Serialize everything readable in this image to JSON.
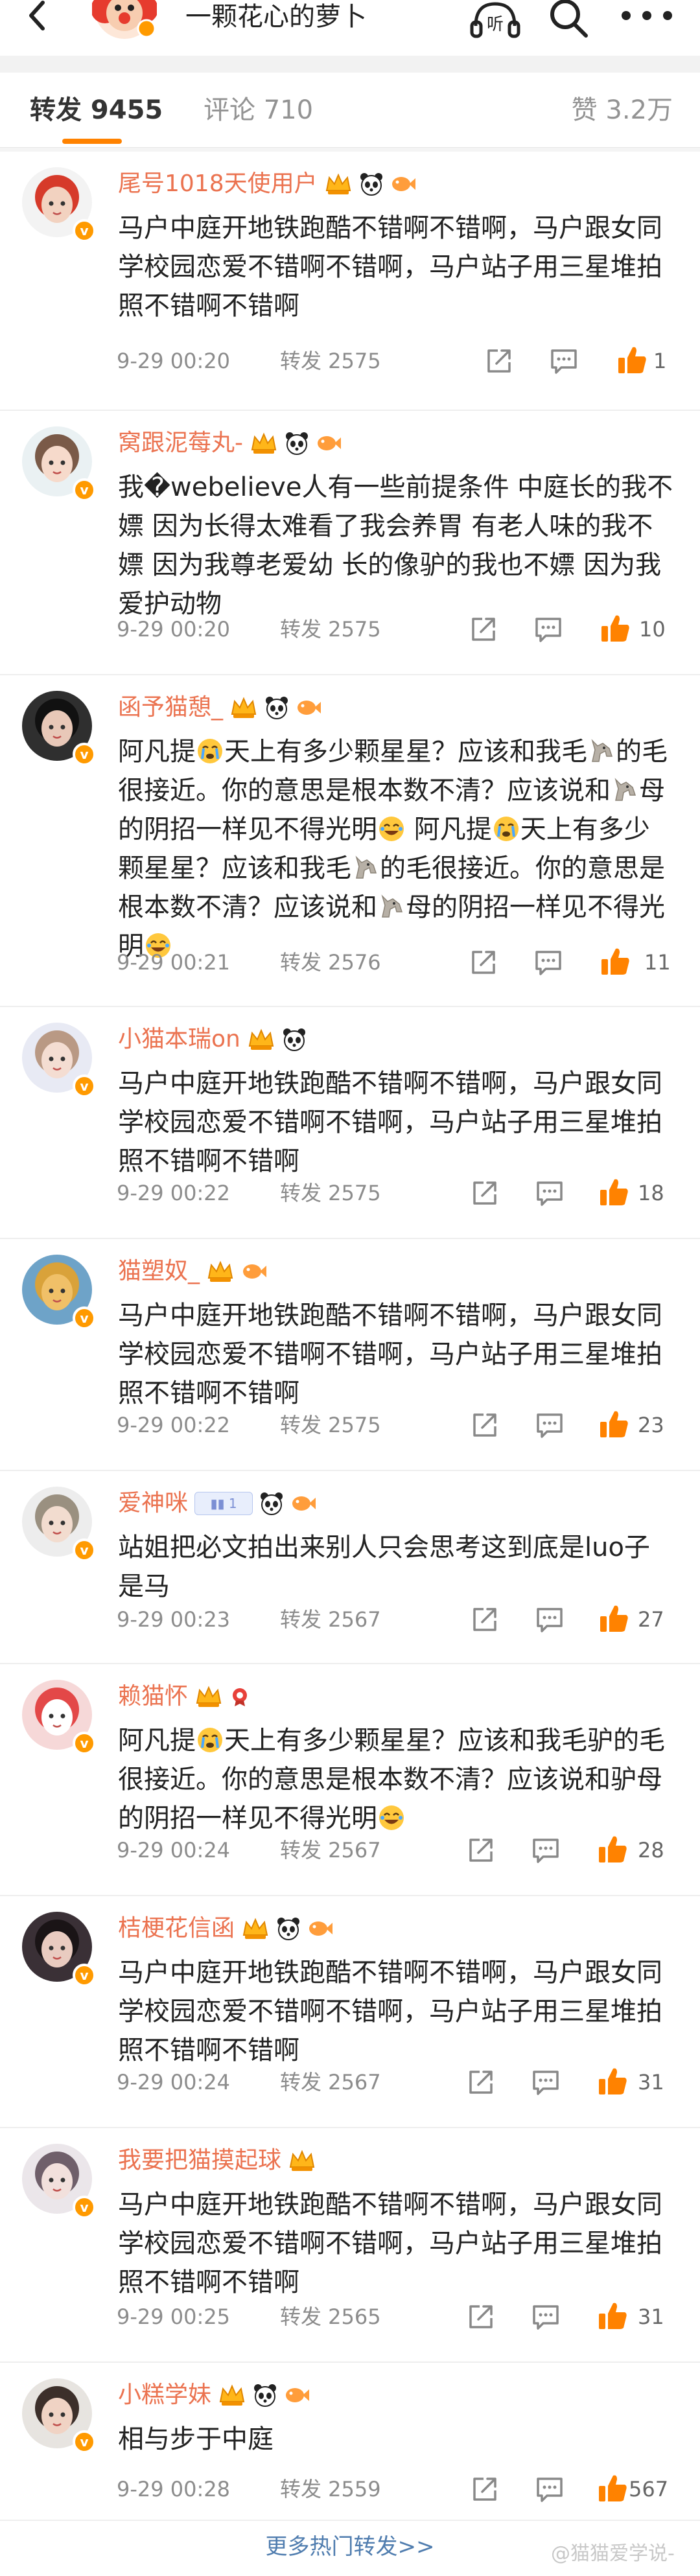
{
  "header": {
    "author_name": "一颗花心的萝卜",
    "listen_label": "听"
  },
  "tabs": {
    "repost": "转发 9455",
    "comment": "评论 710",
    "like": "赞 3.2万"
  },
  "posts": [
    {
      "username": "尾号1018天使用户",
      "text": "马户中庭开地铁跑酷不错啊不错啊，马户跟女同学校园恋爱不错啊不错啊，马户站子用三星堆拍照不错啊不错啊",
      "time": "9-29 00:20",
      "reposts": "转发 2575",
      "likes": "1",
      "liked": true
    },
    {
      "username": "窝跟泥莓丸-",
      "text": "我�webelieve人有一些前提条件  中庭长的我不嫖 因为长得太难看了我会养胃  有老人味的我不嫖 因为我尊老爱幼 长的像驴的我也不嫖 因为我爱护动物",
      "time": "9-29 00:20",
      "reposts": "转发 2575",
      "likes": "10",
      "liked": false
    },
    {
      "username": "函予猫憩_",
      "text_parts": [
        "阿凡提",
        "天上有多少颗星星？应该和我毛",
        "的毛很接近。你的意思是根本数不清？应该说和",
        "母的阴招一样见不得光明",
        " 阿凡提",
        "天上有多少颗星星？应该和我毛",
        "的毛很接近。你的意思是根本数不清？应该说和",
        "母的阴招一样见不得光明"
      ],
      "time": "9-29 00:21",
      "reposts": "转发 2576",
      "likes": "11",
      "liked": false
    },
    {
      "username": "小猫本瑞on",
      "text": "马户中庭开地铁跑酷不错啊不错啊，马户跟女同学校园恋爱不错啊不错啊，马户站子用三星堆拍照不错啊不错啊",
      "time": "9-29 00:22",
      "reposts": "转发 2575",
      "likes": "18",
      "liked": false
    },
    {
      "username": "猫塑奴_",
      "text": "马户中庭开地铁跑酷不错啊不错啊，马户跟女同学校园恋爱不错啊不错啊，马户站子用三星堆拍照不错啊不错啊",
      "time": "9-29 00:22",
      "reposts": "转发 2575",
      "likes": "23",
      "liked": false
    },
    {
      "username": "爱神咪",
      "text": "站姐把必文拍出来别人只会思考这到底是luo子是马",
      "time": "9-29 00:23",
      "reposts": "转发 2567",
      "likes": "27",
      "liked": false
    },
    {
      "username": "赖猫怀",
      "text_parts": [
        "阿凡提",
        "天上有多少颗星星？应该和我毛驴的毛很接近。你的意思是根本数不清？应该说和驴母的阴招一样见不得光明"
      ],
      "time": "9-29 00:24",
      "reposts": "转发 2567",
      "likes": "28",
      "liked": false
    },
    {
      "username": "桔梗花信函",
      "text": "马户中庭开地铁跑酷不错啊不错啊，马户跟女同学校园恋爱不错啊不错啊，马户站子用三星堆拍照不错啊不错啊",
      "time": "9-29 00:24",
      "reposts": "转发 2567",
      "likes": "31",
      "liked": false
    },
    {
      "username": "我要把猫摸起球",
      "text": "马户中庭开地铁跑酷不错啊不错啊，马户跟女同学校园恋爱不错啊不错啊，马户站子用三星堆拍照不错啊不错啊",
      "time": "9-29 00:25",
      "reposts": "转发 2565",
      "likes": "31",
      "liked": false
    },
    {
      "username": "小糕学妹",
      "text": "相与步于中庭",
      "time": "9-29 00:28",
      "reposts": "转发 2559",
      "likes": "567",
      "liked": false
    }
  ],
  "footer": {
    "more_label": "更多热门转发>>",
    "watermark": "@猫猫爱学说-"
  },
  "colors": {
    "accent": "#ff8200",
    "username": "#eb7350",
    "link": "#507daf"
  }
}
